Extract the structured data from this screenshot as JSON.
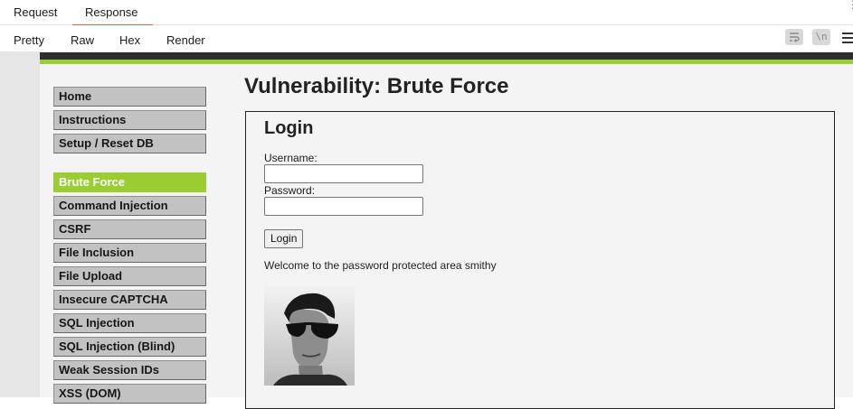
{
  "burp": {
    "top_tabs": [
      "Request",
      "Response"
    ],
    "active_top_tab": "Response",
    "sub_tabs": [
      "Pretty",
      "Raw",
      "Hex",
      "Render"
    ],
    "active_sub_tab": "Render",
    "toolbar": {
      "newline_label": "\\n"
    }
  },
  "dvwa": {
    "accent_color": "#9acd32",
    "menu_group_1": [
      "Home",
      "Instructions",
      "Setup / Reset DB"
    ],
    "menu_group_2": [
      "Brute Force",
      "Command Injection",
      "CSRF",
      "File Inclusion",
      "File Upload",
      "Insecure CAPTCHA",
      "SQL Injection",
      "SQL Injection (Blind)",
      "Weak Session IDs",
      "XSS (DOM)"
    ],
    "selected_menu_item": "Brute Force",
    "page_title": "Vulnerability: Brute Force",
    "login": {
      "title": "Login",
      "username_label": "Username:",
      "username_value": "",
      "password_label": "Password:",
      "password_value": "",
      "button_label": "Login",
      "welcome_message": "Welcome to the password protected area smithy",
      "avatar_icon": "user-photo"
    }
  }
}
